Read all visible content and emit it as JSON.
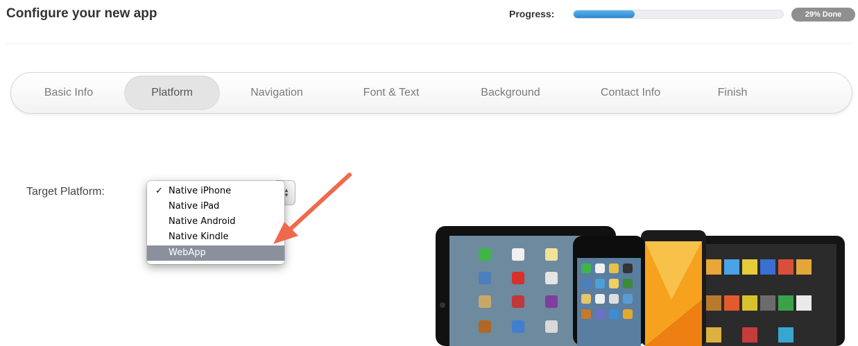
{
  "header": {
    "title": "Configure your new app",
    "progress_label": "Progress:",
    "progress_value": 0.29,
    "progress_badge": "29% Done"
  },
  "tabs": [
    {
      "label": "Basic Info",
      "active": false
    },
    {
      "label": "Platform",
      "active": true
    },
    {
      "label": "Navigation",
      "active": false
    },
    {
      "label": "Font & Text",
      "active": false
    },
    {
      "label": "Background",
      "active": false
    },
    {
      "label": "Contact Info",
      "active": false
    },
    {
      "label": "Finish",
      "active": false
    }
  ],
  "form": {
    "target_platform_label": "Target Platform:",
    "selected_option": "Native iPhone",
    "highlighted_option": "WebApp",
    "options": [
      "Native iPhone",
      "Native iPad",
      "Native Android",
      "Native Kindle",
      "WebApp"
    ]
  },
  "colors": {
    "accent_blue": "#2f86cf",
    "annotation_arrow": "#ef6a4c",
    "highlight_option": "#8a909c"
  },
  "icons": {
    "check": "checkmark-icon",
    "select_arrows": "select-arrows-icon"
  }
}
